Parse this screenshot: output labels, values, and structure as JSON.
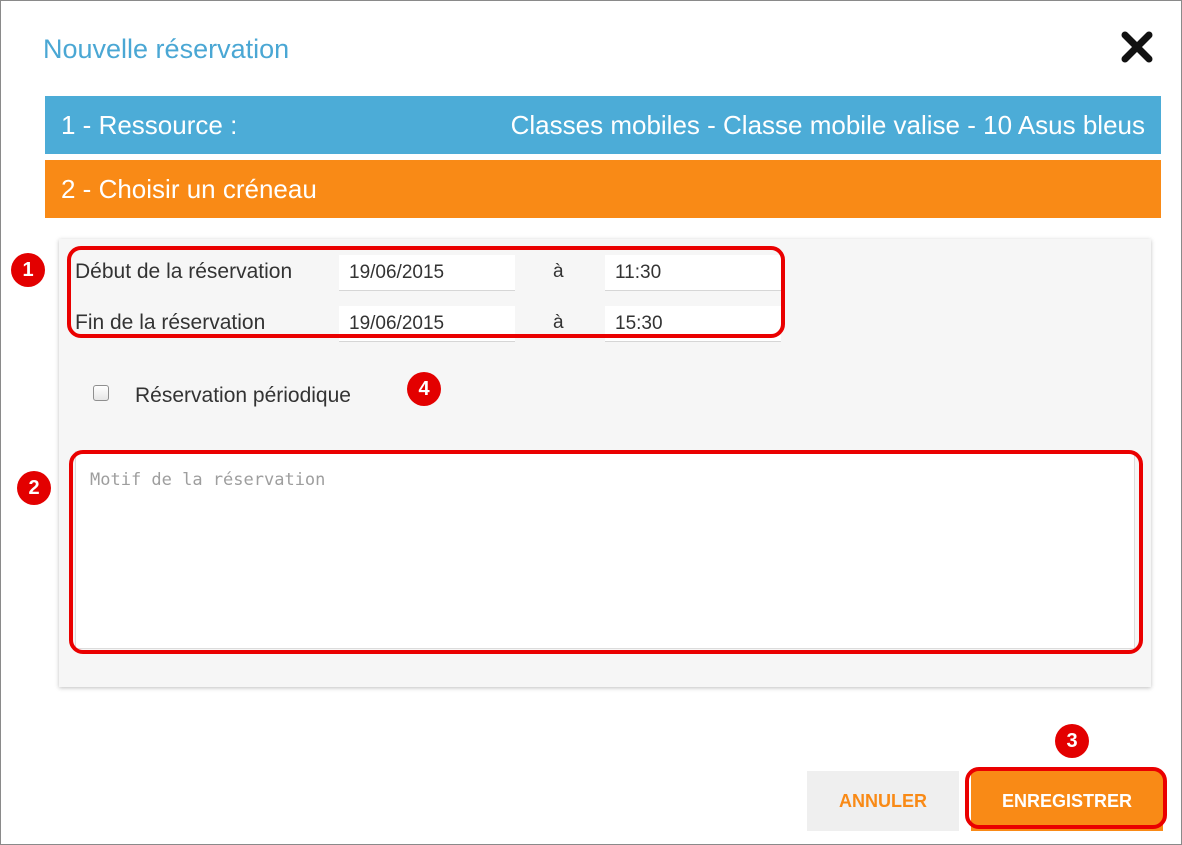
{
  "dialog": {
    "title": "Nouvelle réservation",
    "close_icon": "close-icon"
  },
  "steps": {
    "resource_label": "1 - Ressource :",
    "resource_value": "Classes mobiles - Classe mobile valise - 10 Asus bleus",
    "slot_label": "2 - Choisir un créneau"
  },
  "form": {
    "start_label": "Début de la réservation",
    "start_date": "19/06/2015",
    "start_sep": "à",
    "start_time": "11:30",
    "end_label": "Fin de la réservation",
    "end_date": "19/06/2015",
    "end_sep": "à",
    "end_time": "15:30",
    "periodic_label": "Réservation périodique",
    "periodic_checked": false,
    "reason_placeholder": "Motif de la réservation"
  },
  "buttons": {
    "cancel": "ANNULER",
    "save": "ENREGISTRER"
  },
  "annotations": {
    "b1": "1",
    "b2": "2",
    "b3": "3",
    "b4": "4"
  },
  "colors": {
    "title_blue": "#4aa7d4",
    "bar_blue": "#4cacd7",
    "bar_orange": "#f98a16",
    "annotation_red": "#e30000"
  }
}
